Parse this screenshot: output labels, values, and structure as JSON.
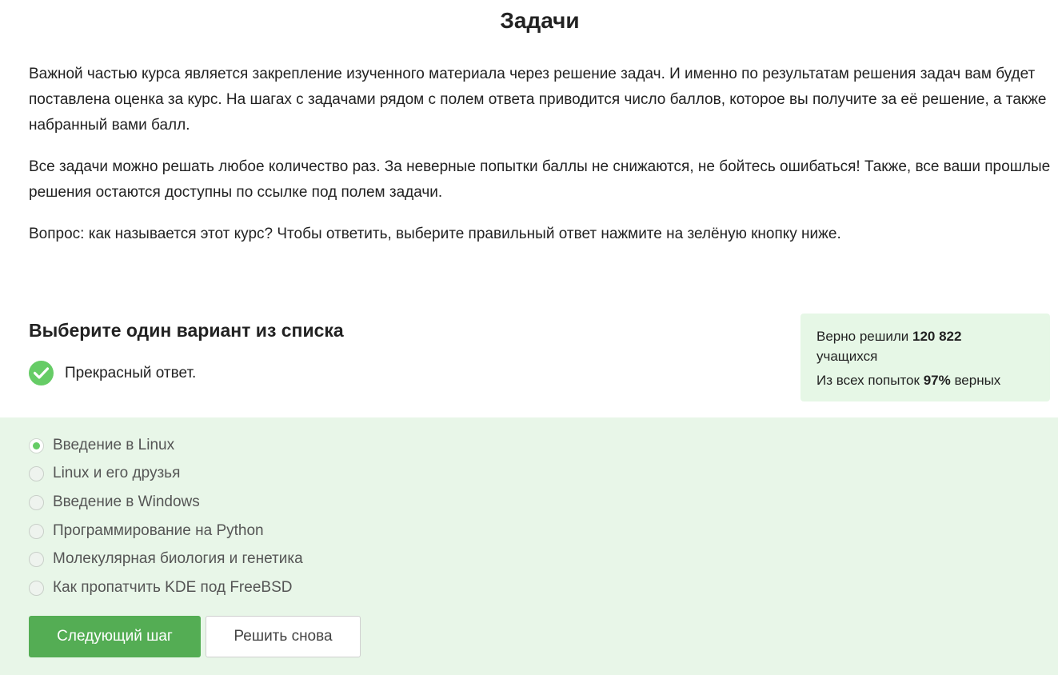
{
  "page": {
    "title": "Задачи",
    "paragraphs": [
      "Важной частью курса является закрепление изученного материала через решение задач. И именно по результатам решения задач вам будет поставлена оценка за курс. На шагах с задачами рядом с полем ответа приводится число баллов, которое вы получите за её решение, а также набранный вами балл.",
      "Все задачи можно решать любое количество раз. За неверные попытки баллы не снижаются, не бойтесь ошибаться! Также, все ваши прошлые решения остаются доступны по ссылке под полем задачи.",
      "Вопрос: как называется этот курс? Чтобы ответить, выберите правильный ответ нажмите на зелёную кнопку ниже."
    ]
  },
  "quiz": {
    "heading": "Выберите один вариант из списка",
    "feedback": "Прекрасный ответ.",
    "options": [
      {
        "label": "Введение в Linux",
        "selected": true
      },
      {
        "label": "Linux и его друзья",
        "selected": false
      },
      {
        "label": "Введение в Windows",
        "selected": false
      },
      {
        "label": "Программирование на Python",
        "selected": false
      },
      {
        "label": "Молекулярная биология и генетика",
        "selected": false
      },
      {
        "label": "Как пропатчить KDE под FreeBSD",
        "selected": false
      }
    ],
    "next_button": "Следующий шаг",
    "retry_button": "Решить снова"
  },
  "stats": {
    "solved_prefix": "Верно решили",
    "solved_count": "120 822",
    "solved_suffix": "учащихся",
    "attempts_prefix": "Из всех попыток",
    "attempts_percent": "97%",
    "attempts_suffix": "верных"
  },
  "colors": {
    "accent_green": "#54ad54",
    "check_green": "#66cc66",
    "options_bg": "#e8f6e8",
    "stats_bg": "#e6f7e6"
  },
  "icons": {
    "feedback": "checkmark-circle-icon",
    "radio_selected": "radio-selected-icon",
    "radio_empty": "radio-empty-icon"
  }
}
